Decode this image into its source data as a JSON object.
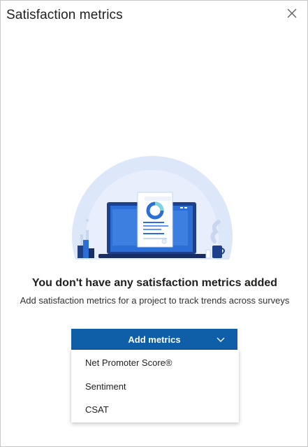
{
  "panel": {
    "title": "Satisfaction metrics"
  },
  "empty_state": {
    "heading": "You don't have any satisfaction metrics added",
    "subtext": "Add satisfaction metrics for a project to track trends across surveys"
  },
  "add_button": {
    "label": "Add metrics"
  },
  "menu": {
    "items": [
      {
        "label": "Net Promoter Score®"
      },
      {
        "label": "Sentiment"
      },
      {
        "label": "CSAT"
      }
    ]
  },
  "colors": {
    "accent": "#0f5ea8",
    "illustration_bg": "#dde7fa",
    "laptop_blue": "#2b6fd6"
  },
  "icons": [
    "close-icon",
    "chevron-down-icon",
    "laptop-report-illustration"
  ]
}
